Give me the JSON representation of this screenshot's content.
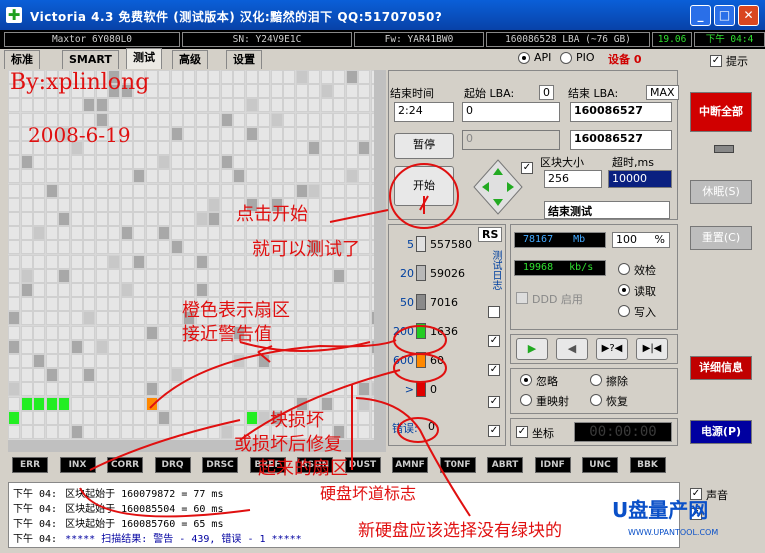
{
  "window": {
    "title": "Victoria 4.3 免费软件 (测试版本) 汉化:黯然的泪下 QQ:51707050?",
    "minimize": "_",
    "maximize": "□",
    "close": "✕"
  },
  "infobar": {
    "model": "Maxtor 6Y080L0",
    "serial": "SN: Y24V9E1C",
    "firmware": "Fw: YAR41BW0",
    "lba": "160086528 LBA (~76 GB)",
    "time_val": "19.06",
    "time_label": "下午 04:4"
  },
  "tabs": [
    "标准",
    "SMART",
    "测试",
    "高级",
    "设置"
  ],
  "mode": {
    "api": "API",
    "pio": "PIO",
    "device": "设备 0"
  },
  "hint": "提示",
  "timing": {
    "end_time_label": "结束时间",
    "start_lba_label": "起始 LBA:",
    "start_lba_mark": "0",
    "end_lba_label": "结束 LBA:",
    "end_lba_mark": "MAX",
    "time_value": "2:24",
    "start_lba_value": "0",
    "end_lba_value": "160086527",
    "disabled_value": "0",
    "end_lba_value2": "160086527"
  },
  "buttons": {
    "pause": "暂停",
    "start": "开始",
    "break_all": "中断全部",
    "sleep": "休眠(S)",
    "reset": "重置(C)",
    "details": "详细信息",
    "power": "电源(P)",
    "rs": "RS"
  },
  "block": {
    "label": "区块大小",
    "timeout_label": "超时,ms",
    "size": "256",
    "timeout": "10000",
    "action": "结束测试"
  },
  "legend": [
    {
      "ms": "5",
      "count": "557580",
      "color": "#e0e0e0"
    },
    {
      "ms": "20",
      "count": "59026",
      "color": "#b8b8b8"
    },
    {
      "ms": "50",
      "count": "7016",
      "color": "#8a8a8a"
    },
    {
      "ms": "200",
      "count": "1636",
      "color": "#22cc22"
    },
    {
      "ms": "600",
      "count": "60",
      "color": "#ff8800"
    },
    {
      "ms": ">",
      "count": "0",
      "color": "#e00000"
    }
  ],
  "legend_error_label": "错误:",
  "legend_error_count": "0",
  "vertical_label": "测试日志",
  "ddd": "DDD 启用",
  "speed": {
    "mb": "78167",
    "mb_unit": "Mb",
    "pct": "100",
    "pct_unit": "%",
    "kbs": "19968",
    "kbs_unit": "kb/s"
  },
  "mode_radios": [
    "效检",
    "读取",
    "写入"
  ],
  "ignore_radios": [
    "忽略",
    "擦除",
    "重映射",
    "恢复"
  ],
  "coord": "坐标",
  "clock": "00:00:00",
  "status_buttons": [
    "ERR",
    "INX",
    "CORR",
    "DRQ",
    "DRSC",
    "BREF",
    "BSDN",
    "DUST",
    "AMNF",
    "T0NF",
    "ABRT",
    "IDNF",
    "UNC",
    "BBK"
  ],
  "sound": "声音",
  "log": [
    {
      "time": "下午 04:",
      "text": "区块起始于 160079872 = 77 ms"
    },
    {
      "time": "下午 04:",
      "text": "区块起始于 160085504 = 60 ms"
    },
    {
      "time": "下午 04:",
      "text": "区块起始于 160085760 = 65 ms"
    },
    {
      "time": "下午 04:",
      "text": "***** 扫描结果: 警告 - 439, 错误 - 1 *****"
    }
  ],
  "annotations": {
    "by": "By:xplinlong",
    "date": "2008-6-19",
    "click": "点击开始",
    "can_test": "就可以测试了",
    "orange1": "橙色表示扇区",
    "orange2": "接近警告值",
    "bad1": "块损坏",
    "bad2": "或损坏后修复",
    "bad3": "起来的扇区",
    "mark": "硬盘坏道标志",
    "new": "新硬盘应该选择没有绿块的",
    "watermark": "U盘量产网",
    "watermark_sub": "WWW.UPANTOOL.COM"
  },
  "colors": {
    "title": "#0a5fd8",
    "green": "#22ee22",
    "orange": "#ff8800",
    "red_ann": "#e01010"
  }
}
